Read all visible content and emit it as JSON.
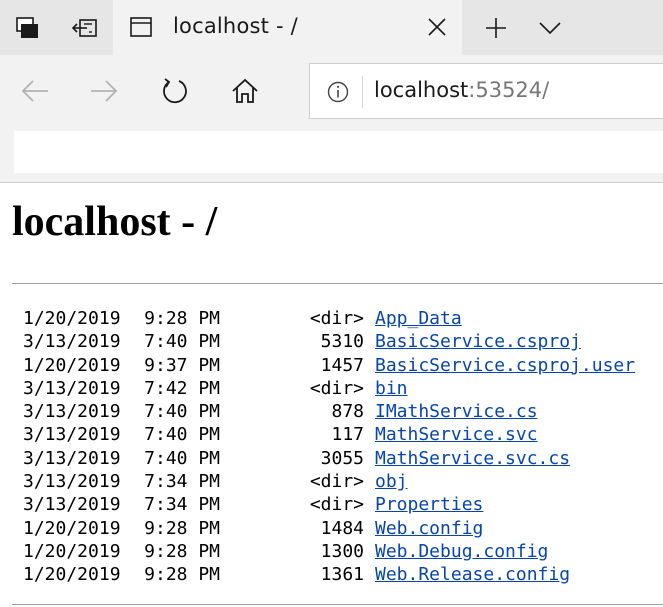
{
  "browser": {
    "tab": {
      "title": "localhost - /"
    },
    "address": {
      "host": "localhost",
      "port": ":53524/"
    },
    "icons": {
      "tab_actions": "tab-actions-icon",
      "set_aside": "set-aside-tabs-icon",
      "tab_favicon": "page-favicon-icon",
      "tab_close": "close-icon",
      "new_tab": "plus-icon",
      "tab_list": "chevron-down-icon",
      "back": "back-arrow-icon",
      "forward": "forward-arrow-icon",
      "refresh": "refresh-icon",
      "home": "home-icon",
      "site_info": "info-icon"
    }
  },
  "page": {
    "heading": "localhost - /",
    "entries": [
      {
        "date": "1/20/2019",
        "time": "9:28 PM",
        "size": "<dir>",
        "name": "App_Data"
      },
      {
        "date": "3/13/2019",
        "time": "7:40 PM",
        "size": "5310",
        "name": "BasicService.csproj"
      },
      {
        "date": "1/20/2019",
        "time": "9:37 PM",
        "size": "1457",
        "name": "BasicService.csproj.user"
      },
      {
        "date": "3/13/2019",
        "time": "7:42 PM",
        "size": "<dir>",
        "name": "bin"
      },
      {
        "date": "3/13/2019",
        "time": "7:40 PM",
        "size": "878",
        "name": "IMathService.cs"
      },
      {
        "date": "3/13/2019",
        "time": "7:40 PM",
        "size": "117",
        "name": "MathService.svc"
      },
      {
        "date": "3/13/2019",
        "time": "7:40 PM",
        "size": "3055",
        "name": "MathService.svc.cs"
      },
      {
        "date": "3/13/2019",
        "time": "7:34 PM",
        "size": "<dir>",
        "name": "obj"
      },
      {
        "date": "3/13/2019",
        "time": "7:34 PM",
        "size": "<dir>",
        "name": "Properties"
      },
      {
        "date": "1/20/2019",
        "time": "9:28 PM",
        "size": "1484",
        "name": "Web.config"
      },
      {
        "date": "1/20/2019",
        "time": "9:28 PM",
        "size": "1300",
        "name": "Web.Debug.config"
      },
      {
        "date": "1/20/2019",
        "time": "9:28 PM",
        "size": "1361",
        "name": "Web.Release.config"
      }
    ]
  },
  "colors": {
    "link": "#0645ad",
    "chrome_background": "#f2f2f2",
    "tabstrip_background": "#e6e6e6"
  }
}
